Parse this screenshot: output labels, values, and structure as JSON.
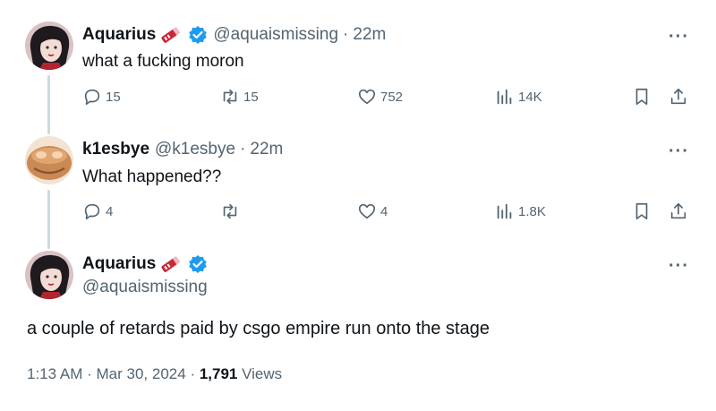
{
  "posts": [
    {
      "display_name": "Aquarius",
      "handle": "@aquaismissing",
      "time": "22m",
      "text": "what a fucking moron",
      "replies": "15",
      "reposts": "15",
      "likes": "752",
      "views": "14K"
    },
    {
      "display_name": "k1esbye",
      "handle": "@k1esbye",
      "time": "22m",
      "text": "What happened??",
      "replies": "4",
      "reposts": "",
      "likes": "4",
      "views": "1.8K"
    }
  ],
  "main_post": {
    "display_name": "Aquarius",
    "handle": "@aquaismissing",
    "text": "a couple of retards paid by csgo empire run onto the stage",
    "time": "1:13 AM",
    "date": "Mar 30, 2024",
    "views_count": "1,791",
    "views_label": "Views"
  },
  "separator": "·",
  "more_glyph": "···",
  "icons": [
    "verified-badge-icon",
    "reply-icon",
    "repost-icon",
    "like-icon",
    "views-icon",
    "bookmark-icon",
    "share-icon",
    "more-icon"
  ],
  "colors": {
    "verified": "#1d9bf0",
    "muted": "#536471",
    "text": "#0f1419",
    "thread_line": "#cfd9de"
  }
}
